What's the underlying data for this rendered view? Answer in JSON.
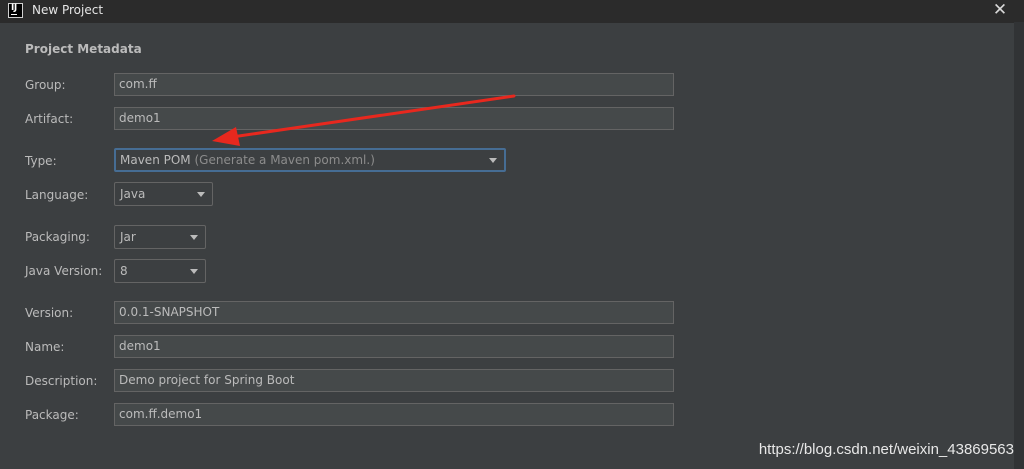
{
  "window": {
    "title": "New Project",
    "app_icon_letters": "IJ"
  },
  "section": {
    "header": "Project Metadata"
  },
  "fields": {
    "group": {
      "label": "Group:",
      "value": "com.ff"
    },
    "artifact": {
      "label": "Artifact:",
      "value": "demo1"
    },
    "type": {
      "label": "Type:",
      "value": "Maven POM",
      "description": "(Generate a Maven pom.xml.)"
    },
    "language": {
      "label": "Language:",
      "value": "Java"
    },
    "packaging": {
      "label": "Packaging:",
      "value": "Jar"
    },
    "java_version": {
      "label": "Java Version:",
      "value": "8"
    },
    "version": {
      "label": "Version:",
      "value": "0.0.1-SNAPSHOT"
    },
    "name": {
      "label": "Name:",
      "value": "demo1"
    },
    "description": {
      "label": "Description:",
      "value": "Demo project for Spring Boot"
    },
    "package": {
      "label": "Package:",
      "value": "com.ff.demo1"
    }
  },
  "watermark": "https://blog.csdn.net/weixin_43869563",
  "colors": {
    "background": "#3c3f41",
    "titlebar": "#2b2b2b",
    "field_bg": "#45494a",
    "focus_border": "#466d94",
    "annotation_arrow": "#e8281e"
  },
  "icons": {
    "close": "close-icon",
    "dropdown": "chevron-down-icon"
  }
}
